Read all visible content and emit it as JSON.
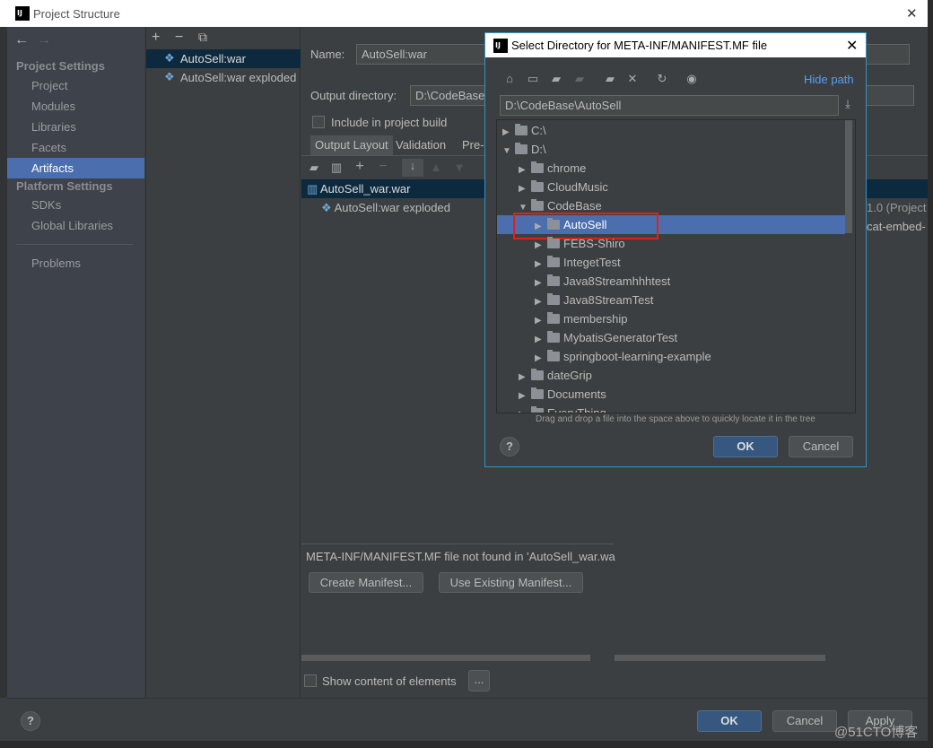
{
  "window": {
    "title": "Project Structure",
    "close": "✕"
  },
  "nav": {
    "back": "←",
    "forward": "→"
  },
  "sidebar": {
    "project_settings": "Project Settings",
    "items1": [
      "Project",
      "Modules",
      "Libraries",
      "Facets",
      "Artifacts"
    ],
    "platform_settings": "Platform Settings",
    "items2": [
      "SDKs",
      "Global Libraries"
    ],
    "problems": "Problems",
    "selected": "Artifacts"
  },
  "artifacts": {
    "toolbar": [
      "+",
      "−",
      "⧉"
    ],
    "items": [
      "AutoSell:war",
      "AutoSell:war exploded"
    ]
  },
  "details": {
    "name_label": "Name:",
    "name_value": "AutoSell:war",
    "output_label": "Output directory:",
    "output_value": "D:\\CodeBase\\",
    "include_label": "Include in project build",
    "tabs": [
      "Output Layout",
      "Validation",
      "Pre-"
    ],
    "layout_items": [
      "AutoSell_war.war",
      "AutoSell:war exploded"
    ],
    "right_texts": [
      "1.0 (Project",
      "cat-embed-"
    ],
    "manifest_msg": "META-INF/MANIFEST.MF file not found in 'AutoSell_war.wa",
    "create_manifest": "Create Manifest...",
    "use_existing": "Use Existing Manifest...",
    "show_content": "Show content of elements",
    "more": "..."
  },
  "footer": {
    "ok": "OK",
    "cancel": "Cancel",
    "apply": "Apply",
    "help": "?"
  },
  "dialog": {
    "title": "Select Directory for META-INF/MANIFEST.MF file",
    "close": "✕",
    "hide_path": "Hide path",
    "path": "D:\\CodeBase\\AutoSell",
    "hint": "Drag and drop a file into the space above to quickly locate it in the tree",
    "ok": "OK",
    "cancel": "Cancel",
    "help": "?",
    "tree": [
      {
        "label": "C:\\",
        "depth": 0,
        "expanded": false
      },
      {
        "label": "D:\\",
        "depth": 0,
        "expanded": true
      },
      {
        "label": "chrome",
        "depth": 1
      },
      {
        "label": "CloudMusic",
        "depth": 1
      },
      {
        "label": "CodeBase",
        "depth": 1,
        "expanded": true
      },
      {
        "label": "AutoSell",
        "depth": 2,
        "selected": true
      },
      {
        "label": "FEBS-Shiro",
        "depth": 2
      },
      {
        "label": "IntegetTest",
        "depth": 2
      },
      {
        "label": "Java8Streamhhhtest",
        "depth": 2
      },
      {
        "label": "Java8StreamTest",
        "depth": 2
      },
      {
        "label": "membership",
        "depth": 2
      },
      {
        "label": "MybatisGeneratorTest",
        "depth": 2
      },
      {
        "label": "springboot-learning-example",
        "depth": 2
      },
      {
        "label": "dateGrip",
        "depth": 1
      },
      {
        "label": "Documents",
        "depth": 1
      },
      {
        "label": "EveryThing",
        "depth": 1
      }
    ]
  },
  "watermark": "@51CTO博客",
  "colors": {
    "selection": "#4b6eaf",
    "highlight_box": "#e02020",
    "accent_link": "#589df6"
  }
}
